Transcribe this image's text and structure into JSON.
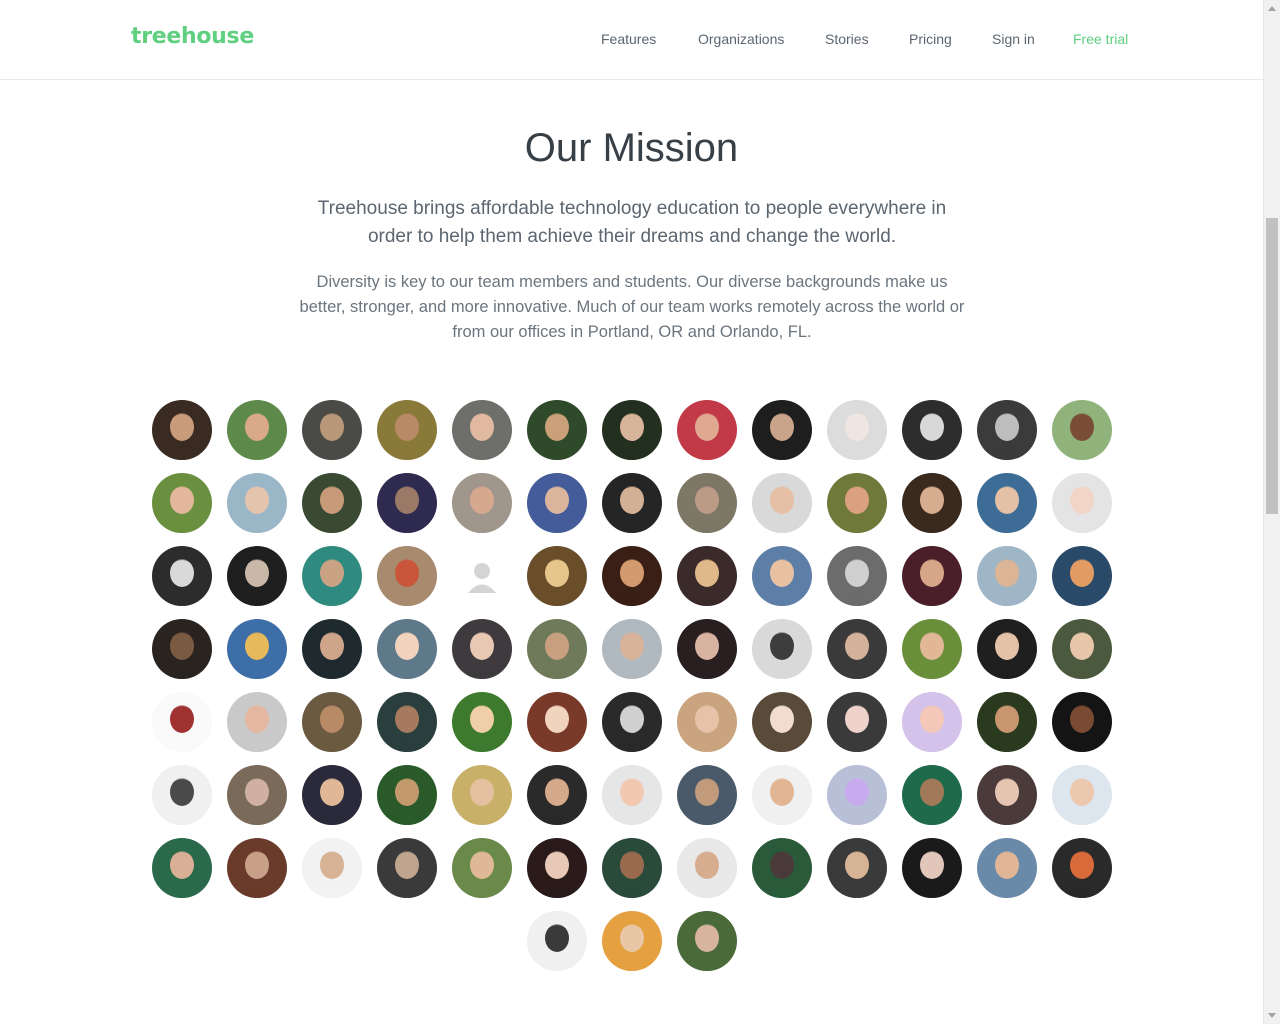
{
  "brand": {
    "name": "treehouse",
    "color": "#5fcf80"
  },
  "nav": {
    "items": [
      {
        "label": "Features",
        "key": "features"
      },
      {
        "label": "Organizations",
        "key": "organizations"
      },
      {
        "label": "Stories",
        "key": "stories"
      },
      {
        "label": "Pricing",
        "key": "pricing"
      },
      {
        "label": "Sign in",
        "key": "sign-in"
      },
      {
        "label": "Free trial",
        "key": "free-trial",
        "accent": true
      }
    ]
  },
  "mission": {
    "title": "Our Mission",
    "lead": "Treehouse brings affordable technology education to people everywhere in order to help them achieve their dreams and change the world.",
    "body": "Diversity is key to our team members and students. Our diverse backgrounds make us better, stronger, and more innovative. Much of our team works remotely across the world or from our offices in Portland, OR and Orlando, FL."
  },
  "team": {
    "member_count": 94,
    "per_row": 13,
    "placeholder_index": 30,
    "palette": [
      [
        "#3a2b22",
        "#c89b7b"
      ],
      [
        "#5d8a4a",
        "#d9a98a"
      ],
      [
        "#4a4a46",
        "#b9987a"
      ],
      [
        "#8a7a3a",
        "#b98a66"
      ],
      [
        "#6e6f6a",
        "#e1b8a0"
      ],
      [
        "#2f4a2a",
        "#caa078"
      ],
      [
        "#23301f",
        "#d8b49b"
      ],
      [
        "#c23a47",
        "#e0a890"
      ],
      [
        "#1e1e1e",
        "#c9a48a"
      ],
      [
        "#dcdcdc",
        "#efe6e1"
      ],
      [
        "#2d2d2d",
        "#d8d8d8"
      ],
      [
        "#3b3b3b",
        "#bdbdbd"
      ],
      [
        "#8fb37b",
        "#7a4e36"
      ],
      [
        "#6a8f3e",
        "#e3b79b"
      ],
      [
        "#9ab7c8",
        "#e5c4ae"
      ],
      [
        "#3a4a32",
        "#c89a78"
      ],
      [
        "#2e2a50",
        "#9a7a66"
      ],
      [
        "#a0968c",
        "#d6a88e"
      ],
      [
        "#445c9a",
        "#dbb49c"
      ],
      [
        "#252525",
        "#d2b096"
      ],
      [
        "#7d7766",
        "#bb9a86"
      ],
      [
        "#d9d9d9",
        "#e5bfa6"
      ],
      [
        "#6f7a3a",
        "#dba07f"
      ],
      [
        "#3a2a1e",
        "#d6ad8e"
      ],
      [
        "#3d6d96",
        "#e3c0a6"
      ],
      [
        "#e4e4e4",
        "#f1d5c6"
      ],
      [
        "#2c2c2c",
        "#d9d9d9"
      ],
      [
        "#1f1f1f",
        "#c9b7a8"
      ],
      [
        "#2f8a7f",
        "#caa384"
      ],
      [
        "#a88a6e",
        "#c9563a"
      ],
      [
        "#f5f5f5",
        "#cfcfcf"
      ],
      [
        "#6a4e2a",
        "#e7c68c"
      ],
      [
        "#3a1f16",
        "#d39a6e"
      ],
      [
        "#3b2a2a",
        "#e0b98a"
      ],
      [
        "#5d7ea6",
        "#e8c1a3"
      ],
      [
        "#6c6c6c",
        "#cfcfcf"
      ],
      [
        "#4a1f2a",
        "#d7a688"
      ],
      [
        "#9fb6c7",
        "#dcb496"
      ],
      [
        "#2a4a6a",
        "#e29b62"
      ],
      [
        "#2a2420",
        "#7b5a42"
      ],
      [
        "#3d6ea8",
        "#e6b95a"
      ],
      [
        "#1e2a2e",
        "#cfa58a"
      ],
      [
        "#5e7a8a",
        "#f2d3bd"
      ],
      [
        "#3e3a3e",
        "#e8c7b3"
      ],
      [
        "#6e7a5a",
        "#c8a080"
      ],
      [
        "#b0b8c0",
        "#d8b39a"
      ],
      [
        "#2a1f20",
        "#d9b3a1"
      ],
      [
        "#d9d9d9",
        "#3d3d3d"
      ],
      [
        "#3a3a3a",
        "#d3b19b"
      ],
      [
        "#6a8f3a",
        "#e1b796"
      ],
      [
        "#1f1f1f",
        "#e3c2a8"
      ],
      [
        "#4b5a3e",
        "#e8c6aa"
      ],
      [
        "#fafafa",
        "#a13232"
      ],
      [
        "#c9c9c9",
        "#e4b8a0"
      ],
      [
        "#6a5a40",
        "#b88a66"
      ],
      [
        "#2a3e3e",
        "#a67a5e"
      ],
      [
        "#3e7a2e",
        "#f0cfa8"
      ],
      [
        "#7a3a2a",
        "#f0d4be"
      ],
      [
        "#2a2a2a",
        "#d0d0d0"
      ],
      [
        "#caa47e",
        "#e7c2a8"
      ],
      [
        "#5a4a3a",
        "#f2dccd"
      ],
      [
        "#3a3a3a",
        "#f0d2cc"
      ],
      [
        "#d5c2ea",
        "#f3c8b8"
      ],
      [
        "#2a3a1f",
        "#c8966e"
      ],
      [
        "#141414",
        "#7a4a32"
      ],
      [
        "#f0f0f0",
        "#4a4a4a"
      ],
      [
        "#7a6a5a",
        "#d0b0a0"
      ],
      [
        "#2a2a3a",
        "#e0b898"
      ],
      [
        "#2a5a2a",
        "#c39a6e"
      ],
      [
        "#c8b068",
        "#e5c0a0"
      ],
      [
        "#2a2a2a",
        "#d4aa8a"
      ],
      [
        "#e6e6e6",
        "#f2c8b0"
      ],
      [
        "#4a5a6a",
        "#c29a7c"
      ],
      [
        "#f0f0f0",
        "#e2b694"
      ],
      [
        "#b8c0d8",
        "#c8aaee"
      ],
      [
        "#1e6a4a",
        "#a27a5a"
      ],
      [
        "#4a3a3a",
        "#e6c4b2"
      ],
      [
        "#dde6ee",
        "#ecc8ae"
      ],
      [
        "#2a6a4a",
        "#d9b095"
      ],
      [
        "#6a3a2a",
        "#c8a088"
      ],
      [
        "#f2f2f2",
        "#d8b294"
      ],
      [
        "#3a3a3a",
        "#bfa48e"
      ],
      [
        "#6a8a4a",
        "#dfb898"
      ],
      [
        "#2a1a1a",
        "#e8c8b6"
      ],
      [
        "#2a4a3a",
        "#9a6a4e"
      ],
      [
        "#e8e8e8",
        "#d7ad90"
      ],
      [
        "#2a5a3a",
        "#4a3a3a"
      ],
      [
        "#3a3a3a",
        "#d7b396"
      ],
      [
        "#1a1a1a",
        "#e2c6ba"
      ],
      [
        "#6a8aaa",
        "#e1b696"
      ],
      [
        "#2a2a2a",
        "#d96a3a"
      ],
      [
        "#f0f0f0",
        "#3a3a3a"
      ],
      [
        "#e5a040",
        "#e8c6a6"
      ],
      [
        "#4a6a3a",
        "#d8b49e"
      ]
    ]
  }
}
